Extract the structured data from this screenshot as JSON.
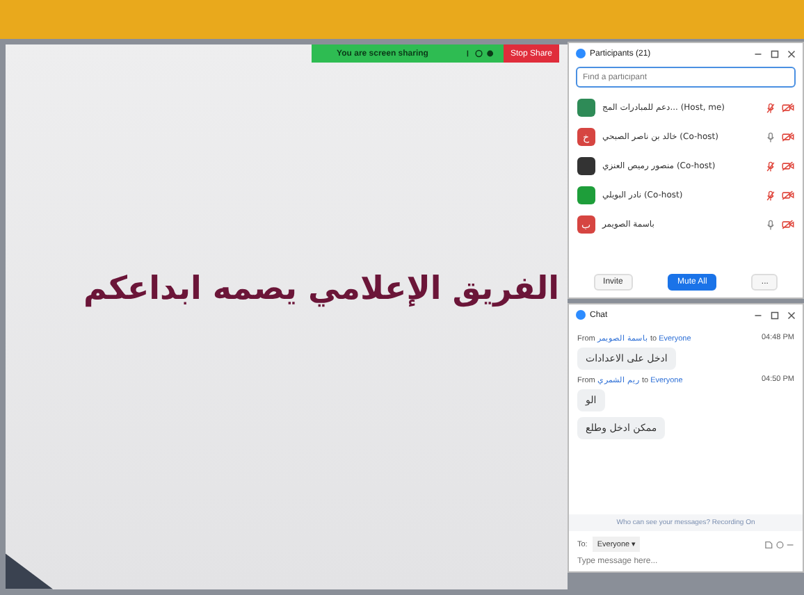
{
  "share_bar": {
    "status": "You are screen sharing",
    "stop_label": "Stop Share"
  },
  "slide": {
    "title": "الفريق الإعلامي يصمه ابداعكم"
  },
  "participants": {
    "title": "Participants (21)",
    "search": {
      "placeholder": "Find a participant"
    },
    "rows": [
      {
        "name": "دعم للمبادرات المج... (Host, me)",
        "avatar": "",
        "color": "#2e8b57",
        "muted": true,
        "video_off": true
      },
      {
        "name": "خالد بن ناصر الصبحي (Co-host)",
        "avatar": "خ",
        "color": "#d64541",
        "muted": false,
        "video_off": true
      },
      {
        "name": "منصور رميص العنزي (Co-host)",
        "avatar": "",
        "color": "#333333",
        "muted": true,
        "video_off": true
      },
      {
        "name": "نادر البويلي (Co-host)",
        "avatar": "",
        "color": "#1e9e3a",
        "muted": true,
        "video_off": true
      },
      {
        "name": "باسمة الصويمر",
        "avatar": "ب",
        "color": "#d64541",
        "muted": false,
        "video_off": true
      }
    ],
    "invite_button": "Invite",
    "mute_all_button": "Mute All",
    "more_button": "..."
  },
  "chat": {
    "title": "Chat",
    "messages": [
      {
        "from_word": "From",
        "from": "باسمة الصويمر",
        "to_word": "to",
        "to": "Everyone",
        "time": "04:48 PM",
        "bubbles": [
          "ادخل على الاعدادات"
        ]
      },
      {
        "from_word": "From",
        "from": "ريم الشمري",
        "to_word": "to",
        "to": "Everyone",
        "time": "04:50 PM",
        "bubbles": [
          "الو",
          "ممكن ادخل وطلع"
        ]
      }
    ],
    "notice": "Who can see your messages? Recording On",
    "to_label": "To:",
    "recipient": "Everyone ▾",
    "input": {
      "placeholder": "Type message here..."
    }
  }
}
